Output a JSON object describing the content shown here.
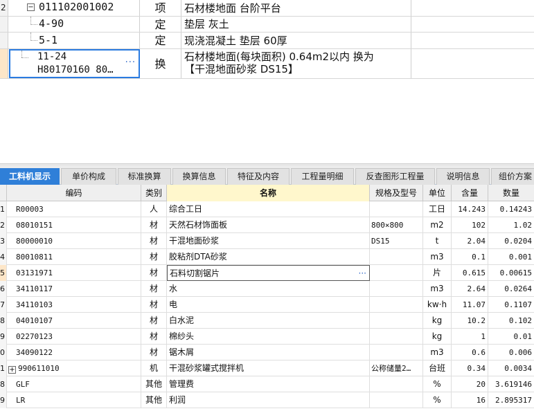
{
  "upper_rows": [
    {
      "idx": "2",
      "code": "011102001002",
      "type": "项",
      "name": "石材楼地面 台阶平台"
    },
    {
      "idx": "",
      "code": "4-90",
      "type": "定",
      "name": "垫层 灰土"
    },
    {
      "idx": "",
      "code": "5-1",
      "type": "定",
      "name": "现浇混凝土 垫层 60厚"
    },
    {
      "idx": "",
      "code_line1": "11-24",
      "code_line2": "H80170160 80…",
      "code_dots": "···",
      "type": "换",
      "name_line1": "石材楼地面(每块面积) 0.64m2以内  换为",
      "name_line2": "【干混地面砂浆 DS15】"
    }
  ],
  "tabs": [
    "工料机显示",
    "单价构成",
    "标准换算",
    "换算信息",
    "特征及内容",
    "工程量明细",
    "反查图形工程量",
    "说明信息",
    "组价方案"
  ],
  "columns": {
    "code": "编码",
    "category": "类别",
    "name": "名称",
    "spec": "规格及型号",
    "unit": "单位",
    "content": "含量",
    "quantity": "数量"
  },
  "rows": [
    {
      "idx": "1",
      "code": "R00003",
      "category": "人",
      "name": "综合工日",
      "spec": "",
      "unit": "工日",
      "content": "14.243",
      "quantity": "0.14243"
    },
    {
      "idx": "2",
      "code": "08010151",
      "category": "材",
      "name": "天然石材饰面板",
      "spec": "800×800",
      "unit": "m2",
      "content": "102",
      "quantity": "1.02"
    },
    {
      "idx": "3",
      "code": "80000010",
      "category": "材",
      "name": "干混地面砂浆",
      "spec": "DS15",
      "unit": "t",
      "content": "2.04",
      "quantity": "0.0204"
    },
    {
      "idx": "4",
      "code": "80010811",
      "category": "材",
      "name": "胶粘剂DTA砂浆",
      "spec": "",
      "unit": "m3",
      "content": "0.1",
      "quantity": "0.001"
    },
    {
      "idx": "5",
      "code": "03131971",
      "category": "材",
      "name": "石料切割锯片",
      "spec": "",
      "unit": "片",
      "content": "0.615",
      "quantity": "0.00615"
    },
    {
      "idx": "6",
      "code": "34110117",
      "category": "材",
      "name": "水",
      "spec": "",
      "unit": "m3",
      "content": "2.64",
      "quantity": "0.0264"
    },
    {
      "idx": "7",
      "code": "34110103",
      "category": "材",
      "name": "电",
      "spec": "",
      "unit": "kw·h",
      "content": "11.07",
      "quantity": "0.1107"
    },
    {
      "idx": "8",
      "code": "04010107",
      "category": "材",
      "name": "白水泥",
      "spec": "",
      "unit": "kg",
      "content": "10.2",
      "quantity": "0.102"
    },
    {
      "idx": "9",
      "code": "02270123",
      "category": "材",
      "name": "棉纱头",
      "spec": "",
      "unit": "kg",
      "content": "1",
      "quantity": "0.01"
    },
    {
      "idx": "0",
      "code": "34090122",
      "category": "材",
      "name": "锯木屑",
      "spec": "",
      "unit": "m3",
      "content": "0.6",
      "quantity": "0.006"
    },
    {
      "idx": "1",
      "code": "990611010",
      "category": "机",
      "name": "干混砂浆罐式搅拌机",
      "spec": "公称储量2…",
      "unit": "台班",
      "content": "0.34",
      "quantity": "0.0034"
    },
    {
      "idx": "8",
      "code": "GLF",
      "category": "其他",
      "name": "管理费",
      "spec": "",
      "unit": "%",
      "content": "20",
      "quantity": "3.619146"
    },
    {
      "idx": "9",
      "code": "LR",
      "category": "其他",
      "name": "利润",
      "spec": "",
      "unit": "%",
      "content": "16",
      "quantity": "2.895317"
    }
  ],
  "editing_dots": "···",
  "icons": {
    "collapse": "minus-box-icon",
    "expand": "plus-box-icon",
    "more": "ellipsis-icon"
  },
  "colors": {
    "active_tab": "#2f7fd8",
    "selection": "#2a7be0",
    "name_header": "#fff7cc"
  }
}
